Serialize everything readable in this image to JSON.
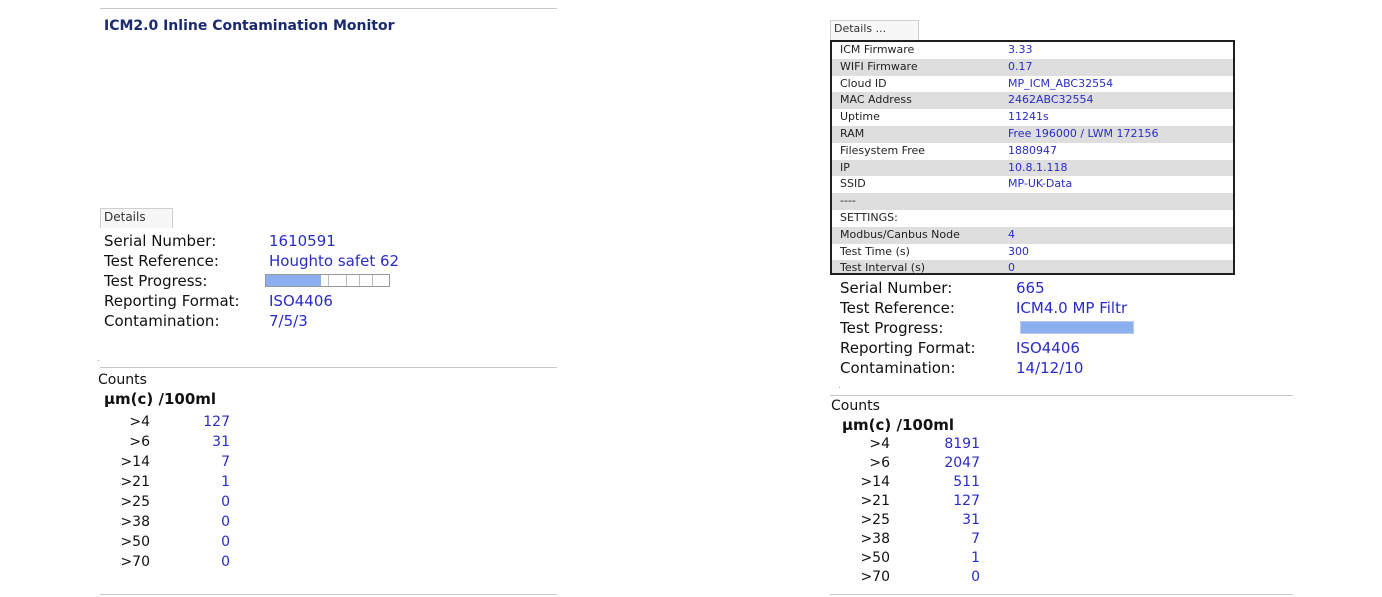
{
  "left": {
    "title": "ICM2.0 Inline Contamination Monitor",
    "details_tab": "Details",
    "fields": [
      {
        "label": "Serial Number:",
        "value": "1610591"
      },
      {
        "label": "Test Reference:",
        "value": "Houghto safet 62"
      },
      {
        "label": "Test Progress:",
        "value": ""
      },
      {
        "label": "Reporting Format:",
        "value": "ISO4406"
      },
      {
        "label": "Contamination:",
        "value": "7/5/3"
      }
    ],
    "progress": 0.45,
    "counts": {
      "title": "Counts",
      "header": "µm(c)  /100ml",
      "rows": [
        {
          "size": ">4",
          "count": "127"
        },
        {
          "size": ">6",
          "count": "31"
        },
        {
          "size": ">14",
          "count": "7"
        },
        {
          "size": ">21",
          "count": "1"
        },
        {
          "size": ">25",
          "count": "0"
        },
        {
          "size": ">38",
          "count": "0"
        },
        {
          "size": ">50",
          "count": "0"
        },
        {
          "size": ">70",
          "count": "0"
        }
      ]
    }
  },
  "right": {
    "details_tab": "Details ...",
    "details": [
      {
        "key": "ICM Firmware",
        "value": "3.33"
      },
      {
        "key": "WIFI Firmware",
        "value": "0.17"
      },
      {
        "key": "Cloud ID",
        "value": "MP_ICM_ABC32554"
      },
      {
        "key": "MAC Address",
        "value": "2462ABC32554"
      },
      {
        "key": "Uptime",
        "value": "11241s"
      },
      {
        "key": "RAM",
        "value": "Free 196000 / LWM 172156"
      },
      {
        "key": "Filesystem Free",
        "value": "1880947"
      },
      {
        "key": "IP",
        "value": "10.8.1.118"
      },
      {
        "key": "SSID",
        "value": "MP-UK-Data"
      },
      {
        "key": "----",
        "value": ""
      },
      {
        "key": "SETTINGS:",
        "value": ""
      },
      {
        "key": "Modbus/Canbus Node",
        "value": "4"
      },
      {
        "key": "Test Time (s)",
        "value": "300"
      },
      {
        "key": "Test Interval (s)",
        "value": "0"
      }
    ],
    "fields": [
      {
        "label": "Serial Number:",
        "value": "665"
      },
      {
        "label": "Test Reference:",
        "value": "ICM4.0 MP Filtr"
      },
      {
        "label": "Test Progress:",
        "value": ""
      },
      {
        "label": "Reporting Format:",
        "value": "ISO4406"
      },
      {
        "label": "Contamination:",
        "value": "14/12/10"
      }
    ],
    "progress": 1.0,
    "counts": {
      "title": "Counts",
      "header": "µm(c)  /100ml",
      "rows": [
        {
          "size": ">4",
          "count": "8191"
        },
        {
          "size": ">6",
          "count": "2047"
        },
        {
          "size": ">14",
          "count": "511"
        },
        {
          "size": ">21",
          "count": "127"
        },
        {
          "size": ">25",
          "count": "31"
        },
        {
          "size": ">38",
          "count": "7"
        },
        {
          "size": ">50",
          "count": "1"
        },
        {
          "size": ">70",
          "count": "0"
        }
      ]
    }
  },
  "colors": {
    "value_text": "#2a2cc4",
    "progress_fill": "#8cb0ef",
    "title_text": "#1a2a6e"
  }
}
